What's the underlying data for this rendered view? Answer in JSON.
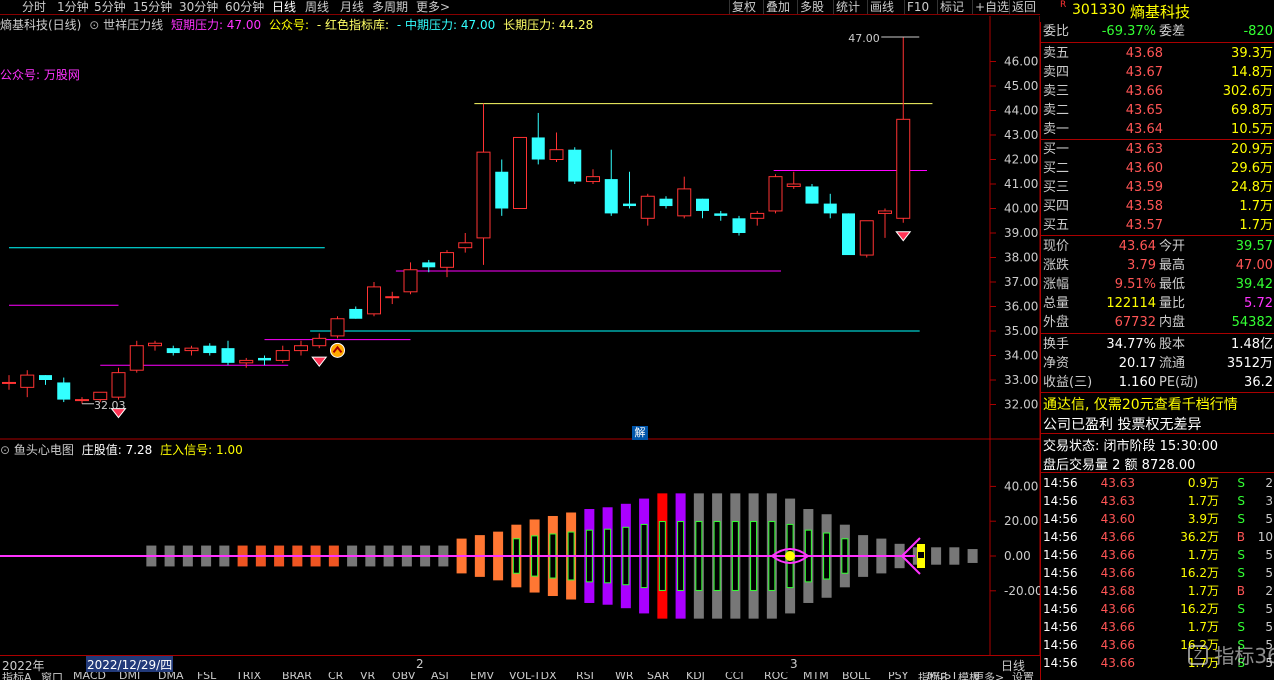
{
  "toolbar": {
    "periods": [
      "分时",
      "1分钟",
      "5分钟",
      "15分钟",
      "30分钟",
      "60分钟",
      "日线",
      "周线",
      "月线",
      "多周期",
      "更多>"
    ],
    "active": "日线",
    "right_buttons": [
      "复权",
      "叠加",
      "多股",
      "统计",
      "画线",
      "F10",
      "标记",
      "+自选",
      "返回"
    ]
  },
  "main_chart": {
    "stock_title": "熵基科技(日线)",
    "indicator_name": "世祥压力线",
    "short_label": "短期压力: 47.00",
    "gzh_label": "公众号:",
    "red_lib_label": "- 红色指标库:",
    "mid_label": "- 中期压力: 47.00",
    "long_label": "长期压力: 44.28",
    "watermark": "公众号: 万股网",
    "high_label": "47.00",
    "low_label": "32.03",
    "jie_label": "解",
    "price_ticks": [
      "46.00",
      "45.00",
      "44.00",
      "43.00",
      "42.00",
      "41.00",
      "40.00",
      "39.00",
      "38.00",
      "37.00",
      "36.00",
      "35.00",
      "34.00",
      "33.00",
      "32.00"
    ],
    "chart_data": {
      "type": "candlestick",
      "ylim": [
        31.6,
        47.2
      ],
      "candles": [
        {
          "o": 32.9,
          "h": 33.2,
          "l": 32.6,
          "c": 32.9
        },
        {
          "o": 32.7,
          "h": 33.4,
          "l": 32.3,
          "c": 33.2
        },
        {
          "o": 33.2,
          "h": 33.2,
          "l": 32.8,
          "c": 33.0
        },
        {
          "o": 32.9,
          "h": 33.1,
          "l": 32.1,
          "c": 32.2
        },
        {
          "o": 32.2,
          "h": 32.3,
          "l": 32.03,
          "c": 32.2
        },
        {
          "o": 32.2,
          "h": 32.5,
          "l": 32.1,
          "c": 32.5
        },
        {
          "o": 32.3,
          "h": 33.5,
          "l": 32.2,
          "c": 33.3
        },
        {
          "o": 33.4,
          "h": 34.6,
          "l": 33.3,
          "c": 34.4
        },
        {
          "o": 34.4,
          "h": 34.6,
          "l": 34.2,
          "c": 34.5
        },
        {
          "o": 34.3,
          "h": 34.4,
          "l": 34.0,
          "c": 34.1
        },
        {
          "o": 34.2,
          "h": 34.4,
          "l": 34.0,
          "c": 34.3
        },
        {
          "o": 34.4,
          "h": 34.5,
          "l": 34.0,
          "c": 34.1
        },
        {
          "o": 34.3,
          "h": 34.6,
          "l": 33.6,
          "c": 33.7
        },
        {
          "o": 33.7,
          "h": 33.9,
          "l": 33.5,
          "c": 33.8
        },
        {
          "o": 33.9,
          "h": 34.0,
          "l": 33.6,
          "c": 33.8
        },
        {
          "o": 33.8,
          "h": 34.4,
          "l": 33.7,
          "c": 34.2
        },
        {
          "o": 34.2,
          "h": 34.6,
          "l": 34.0,
          "c": 34.4
        },
        {
          "o": 34.4,
          "h": 34.9,
          "l": 34.3,
          "c": 34.7
        },
        {
          "o": 34.8,
          "h": 35.6,
          "l": 34.7,
          "c": 35.5
        },
        {
          "o": 35.9,
          "h": 36.0,
          "l": 35.5,
          "c": 35.5
        },
        {
          "o": 35.7,
          "h": 37.0,
          "l": 35.6,
          "c": 36.8
        },
        {
          "o": 36.4,
          "h": 36.6,
          "l": 36.1,
          "c": 36.4
        },
        {
          "o": 36.6,
          "h": 37.8,
          "l": 36.5,
          "c": 37.5
        },
        {
          "o": 37.8,
          "h": 37.9,
          "l": 37.4,
          "c": 37.6
        },
        {
          "o": 37.6,
          "h": 38.3,
          "l": 37.2,
          "c": 38.2
        },
        {
          "o": 38.4,
          "h": 39.0,
          "l": 38.2,
          "c": 38.6
        },
        {
          "o": 38.8,
          "h": 44.28,
          "l": 37.7,
          "c": 42.3
        },
        {
          "o": 41.5,
          "h": 42.0,
          "l": 39.7,
          "c": 40.0
        },
        {
          "o": 40.0,
          "h": 42.9,
          "l": 40.0,
          "c": 42.9
        },
        {
          "o": 42.9,
          "h": 43.9,
          "l": 41.8,
          "c": 42.0
        },
        {
          "o": 42.0,
          "h": 43.1,
          "l": 41.9,
          "c": 42.4
        },
        {
          "o": 42.4,
          "h": 42.5,
          "l": 41.0,
          "c": 41.1
        },
        {
          "o": 41.1,
          "h": 41.6,
          "l": 41.0,
          "c": 41.3
        },
        {
          "o": 41.2,
          "h": 42.4,
          "l": 39.7,
          "c": 39.8
        },
        {
          "o": 40.2,
          "h": 41.5,
          "l": 40.0,
          "c": 40.1
        },
        {
          "o": 39.6,
          "h": 40.6,
          "l": 39.3,
          "c": 40.5
        },
        {
          "o": 40.4,
          "h": 40.5,
          "l": 40.0,
          "c": 40.1
        },
        {
          "o": 39.7,
          "h": 41.3,
          "l": 39.6,
          "c": 40.8
        },
        {
          "o": 40.4,
          "h": 40.4,
          "l": 39.6,
          "c": 39.9
        },
        {
          "o": 39.8,
          "h": 39.9,
          "l": 39.5,
          "c": 39.7
        },
        {
          "o": 39.6,
          "h": 39.7,
          "l": 38.9,
          "c": 39.0
        },
        {
          "o": 39.6,
          "h": 39.9,
          "l": 39.3,
          "c": 39.8
        },
        {
          "o": 39.9,
          "h": 41.4,
          "l": 39.8,
          "c": 41.3
        },
        {
          "o": 40.9,
          "h": 41.5,
          "l": 40.8,
          "c": 41.0
        },
        {
          "o": 40.9,
          "h": 41.0,
          "l": 40.2,
          "c": 40.2
        },
        {
          "o": 40.2,
          "h": 40.6,
          "l": 39.6,
          "c": 39.8
        },
        {
          "o": 39.8,
          "h": 39.8,
          "l": 38.1,
          "c": 38.1
        },
        {
          "o": 38.1,
          "h": 39.5,
          "l": 38.0,
          "c": 39.5
        },
        {
          "o": 39.8,
          "h": 40.0,
          "l": 38.8,
          "c": 39.9
        },
        {
          "o": 39.6,
          "h": 47.0,
          "l": 39.42,
          "c": 43.64
        }
      ],
      "lines": [
        {
          "color": "#00ffff",
          "from": 0,
          "to": 17.3,
          "y": 38.4
        },
        {
          "color": "#ff00ff",
          "from": 0,
          "to": 6,
          "y": 36.05
        },
        {
          "color": "#ff00ff",
          "from": 5,
          "to": 15.3,
          "y": 33.6
        },
        {
          "color": "#ff00ff",
          "from": 14,
          "to": 22,
          "y": 34.65
        },
        {
          "color": "#00ffff",
          "from": 16.5,
          "to": 49.9,
          "y": 35.0
        },
        {
          "color": "#ff00ff",
          "from": 21.2,
          "to": 42.3,
          "y": 37.45
        },
        {
          "color": "#ffff66",
          "from": 25.5,
          "to": 50.6,
          "y": 44.28
        },
        {
          "color": "#ff00ff",
          "from": 41.9,
          "to": 50.3,
          "y": 41.55
        }
      ],
      "signals": [
        {
          "i": 6,
          "type": "gem"
        },
        {
          "i": 17,
          "type": "gem"
        },
        {
          "i": 18,
          "type": "coin"
        },
        {
          "i": 49,
          "type": "gem"
        }
      ]
    }
  },
  "sub_chart": {
    "title": "鱼头心电图",
    "label1": "庄股值: 7.28",
    "label2": "庄入信号: 1.00",
    "ticks": [
      "40.00",
      "20.00",
      "0.00",
      "-20.00"
    ],
    "chart_data": {
      "type": "bar",
      "ylim": [
        -30,
        45
      ],
      "values": [
        6,
        6,
        6,
        6,
        6,
        6,
        6,
        6,
        6,
        6,
        6,
        6,
        6,
        6,
        6,
        6,
        6,
        6,
        10,
        12,
        14,
        18,
        21,
        23,
        25,
        27,
        28,
        30,
        33,
        36,
        36,
        36,
        36,
        36,
        36,
        36,
        33,
        27,
        24,
        18,
        12,
        10,
        7,
        5,
        5,
        5,
        4,
        4,
        0,
        6
      ],
      "colors": [
        "#777",
        "#777",
        "#777",
        "#777",
        "#777",
        "#777",
        "#ee5522",
        "#ee5522",
        "#ee5522",
        "#ee5522",
        "#ee5522",
        "#ee5522",
        "#777",
        "#777",
        "#777",
        "#777",
        "#777",
        "#777",
        "#ff7733",
        "#ff7733",
        "#ff7733",
        "#ff7733",
        "#ff7733",
        "#ff7733",
        "#ff7733",
        "#aa00ff",
        "#aa00ff",
        "#aa00ff",
        "#aa00ff",
        "#ff0000",
        "#aa00ff",
        "#777",
        "#777",
        "#777",
        "#777",
        "#777",
        "#777",
        "#777",
        "#777",
        "#777",
        "#777",
        "#777",
        "#777",
        "#777",
        "#777",
        "#777",
        "#777",
        "#777",
        "#777",
        "#ffff00"
      ]
    }
  },
  "xaxis": {
    "y2022": "2022年",
    "date": "2022/12/29/四",
    "m2": "2",
    "m3": "3",
    "period": "日线"
  },
  "quote": {
    "code": "301330",
    "name": "熵基科技",
    "r": "R",
    "weibi_label": "委比",
    "weibi": "-69.37%",
    "weicha_label": "委差",
    "weicha": "-820",
    "asks": [
      {
        "label": "卖五",
        "price": "43.68",
        "vol": "39.3万"
      },
      {
        "label": "卖四",
        "price": "43.67",
        "vol": "14.8万"
      },
      {
        "label": "卖三",
        "price": "43.66",
        "vol": "302.6万"
      },
      {
        "label": "卖二",
        "price": "43.65",
        "vol": "69.8万"
      },
      {
        "label": "卖一",
        "price": "43.64",
        "vol": "10.5万"
      }
    ],
    "bids": [
      {
        "label": "买一",
        "price": "43.63",
        "vol": "20.9万"
      },
      {
        "label": "买二",
        "price": "43.60",
        "vol": "29.6万"
      },
      {
        "label": "买三",
        "price": "43.59",
        "vol": "24.8万"
      },
      {
        "label": "买四",
        "price": "43.58",
        "vol": "1.7万"
      },
      {
        "label": "买五",
        "price": "43.57",
        "vol": "1.7万"
      }
    ],
    "stats": [
      {
        "l1": "现价",
        "v1": "43.64",
        "l2": "今开",
        "v2": "39.57",
        "c1": "#ff5555",
        "c2": "#33ff33"
      },
      {
        "l1": "涨跌",
        "v1": "3.79",
        "l2": "最高",
        "v2": "47.00",
        "c1": "#ff5555",
        "c2": "#ff5555"
      },
      {
        "l1": "涨幅",
        "v1": "9.51%",
        "l2": "最低",
        "v2": "39.42",
        "c1": "#ff5555",
        "c2": "#33ff33"
      },
      {
        "l1": "总量",
        "v1": "122114",
        "l2": "量比",
        "v2": "5.72",
        "c1": "#ffff00",
        "c2": "#ff33ff"
      },
      {
        "l1": "外盘",
        "v1": "67732",
        "l2": "内盘",
        "v2": "54382",
        "c1": "#ff5555",
        "c2": "#33ff33"
      }
    ],
    "stats2": [
      {
        "l1": "换手",
        "v1": "34.77%",
        "l2": "股本",
        "v2": "1.48亿"
      },
      {
        "l1": "净资",
        "v1": "20.17",
        "l2": "流通",
        "v2": "3512万"
      },
      {
        "l1": "收益(三)",
        "v1": "1.160",
        "l2": "PE(动)",
        "v2": "36.2"
      }
    ],
    "ad": "通达信, 仅需20元查看千档行情",
    "notice": "公司已盈利 投票权无差异",
    "trade_status": "交易状态: 闭市阶段 15:30:00",
    "after_hours": "盘后交易量 2 额 8728.00"
  },
  "ticks": [
    {
      "t": "14:56",
      "p": "43.63",
      "v": "0.9万",
      "s": "S",
      "n": "2"
    },
    {
      "t": "14:56",
      "p": "43.63",
      "v": "1.7万",
      "s": "S",
      "n": "3"
    },
    {
      "t": "14:56",
      "p": "43.60",
      "v": "3.9万",
      "s": "S",
      "n": "5"
    },
    {
      "t": "14:56",
      "p": "43.66",
      "v": "36.2万",
      "s": "B",
      "n": "10"
    },
    {
      "t": "14:56",
      "p": "43.66",
      "v": "1.7万",
      "s": "S",
      "n": "5"
    },
    {
      "t": "14:56",
      "p": "43.66",
      "v": "16.2万",
      "s": "S",
      "n": "5"
    },
    {
      "t": "14:56",
      "p": "43.68",
      "v": "1.7万",
      "s": "B",
      "n": "2"
    },
    {
      "t": "14:56",
      "p": "43.66",
      "v": "16.2万",
      "s": "S",
      "n": "5"
    },
    {
      "t": "14:56",
      "p": "43.66",
      "v": "1.7万",
      "s": "S",
      "n": "5"
    },
    {
      "t": "14:56",
      "p": "43.66",
      "v": "16.2万",
      "s": "S",
      "n": "5"
    },
    {
      "t": "14:56",
      "p": "43.66",
      "v": "1.7万",
      "s": "S",
      "n": "5"
    }
  ],
  "bottom_tabs": [
    "指标A",
    "窗口",
    "MACD",
    "DMI",
    "DMA",
    "FSL",
    "TRIX",
    "BRAR",
    "CR",
    "VR",
    "OBV",
    "ASI",
    "EMV",
    "VOL-TDX",
    "RSI",
    "WR",
    "SAR",
    "KDJ",
    "CCI",
    "ROC",
    "MTM",
    "BOLL",
    "PSY",
    "MCST",
    "更多>",
    "设置"
  ],
  "bottom_right": [
    "指标B",
    "模板"
  ],
  "watermark_brand": "指标365",
  "colors": {
    "up": "#ff3333",
    "down": "#33ffff",
    "accent": "#a00000"
  }
}
